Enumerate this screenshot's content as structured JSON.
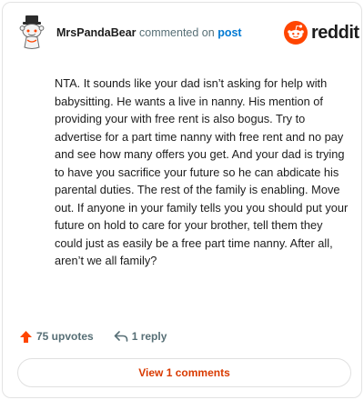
{
  "comment": {
    "username": "MrsPandaBear",
    "verb": "commented on",
    "post_link": "post",
    "body": "NTA. It sounds like your dad isn’t asking for help with babysitting. He wants a live in nanny. His mention of providing your with free rent is also bogus. Try to advertise for a part time nanny with free rent and no pay and see how many offers you get. And your dad is trying to have you sacrifice your future so he can abdicate his parental duties. The rest of the family is enabling. Move out. If anyone in your family tells you you should put your future on hold to care for your brother, tell them they could just as easily be a free part time nanny. After all, aren’t we all family?"
  },
  "brand": {
    "wordmark": "reddit",
    "color": "#ff4500"
  },
  "actions": {
    "upvotes_label": "75 upvotes",
    "reply_label": "1 reply",
    "upvote_icon": "upvote-arrow-icon",
    "reply_icon": "reply-arrow-icon"
  },
  "footer": {
    "view_comments_label": "View 1 comments"
  },
  "colors": {
    "accent": "#ff4500",
    "link": "#0079d3",
    "muted": "#576f76",
    "button_text": "#d93a00"
  }
}
